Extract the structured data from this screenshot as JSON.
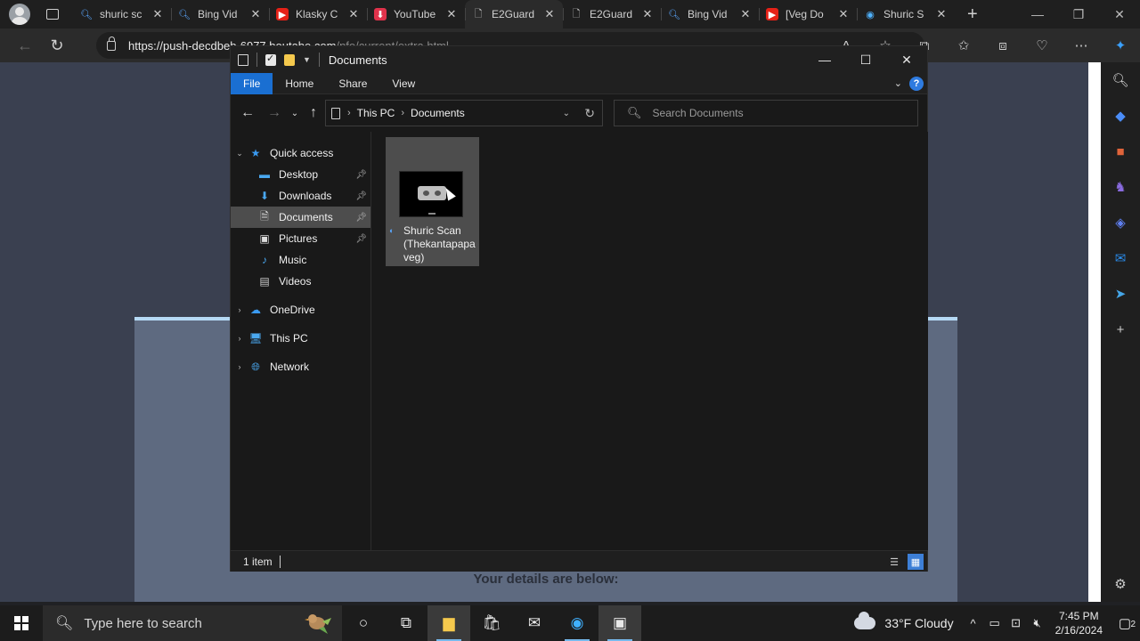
{
  "browser": {
    "tabs": [
      {
        "icon": "search-icon",
        "label": "shuric sc"
      },
      {
        "icon": "search-icon",
        "label": "Bing Vid"
      },
      {
        "icon": "youtube-icon",
        "label": "Klasky C"
      },
      {
        "icon": "download-icon",
        "label": "YouTube"
      },
      {
        "icon": "document-icon",
        "label": "E2Guard"
      },
      {
        "icon": "document-icon",
        "label": "E2Guard"
      },
      {
        "icon": "search-icon",
        "label": "Bing Vid"
      },
      {
        "icon": "youtube-icon",
        "label": "[Veg Do"
      },
      {
        "icon": "edge-icon",
        "label": "Shuric S"
      }
    ],
    "active_tab_index": 4,
    "url_host": "https://push-decdbeb-6977.boutabe.com",
    "url_path": "/nfo/current/extra.html"
  },
  "page": {
    "details_heading": "Your details are below:"
  },
  "explorer": {
    "title": "Documents",
    "ribbon_tabs": [
      "File",
      "Home",
      "Share",
      "View"
    ],
    "breadcrumb": [
      "This PC",
      "Documents"
    ],
    "search_placeholder": "Search Documents",
    "nav": {
      "quick_access": "Quick access",
      "items": [
        {
          "label": "Desktop",
          "pinned": true
        },
        {
          "label": "Downloads",
          "pinned": true
        },
        {
          "label": "Documents",
          "pinned": true
        },
        {
          "label": "Pictures",
          "pinned": true
        },
        {
          "label": "Music",
          "pinned": false
        },
        {
          "label": "Videos",
          "pinned": false
        }
      ],
      "roots": [
        "OneDrive",
        "This PC",
        "Network"
      ]
    },
    "files": [
      {
        "name": "Shuric Scan (Thekantapapa veg)"
      }
    ],
    "status": "1 item"
  },
  "taskbar": {
    "search_placeholder": "Type here to search",
    "weather": "33°F  Cloudy",
    "time": "7:45 PM",
    "date": "2/16/2024",
    "notifications": "2"
  }
}
